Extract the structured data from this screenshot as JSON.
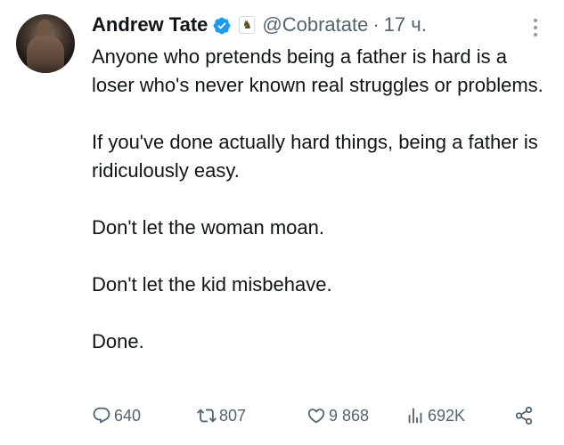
{
  "author": {
    "name": "Andrew Tate",
    "handle": "@Cobratate",
    "separator": "·",
    "time": "17 ч.",
    "verified_color": "#1d9bf0"
  },
  "tweet": {
    "paragraphs": [
      "Anyone who pretends being a father is hard is a loser who's never known real struggles or problems.",
      "If you've done actually hard things, being a father is ridiculously easy.",
      "Don't let the woman moan.",
      "Don't let the kid misbehave.",
      "Done."
    ]
  },
  "actions": {
    "replies": "640",
    "reposts": "807",
    "likes": "9 868",
    "views": "692K"
  },
  "icons": {
    "more": "more-vertical-icon",
    "reply": "reply-icon",
    "repost": "repost-icon",
    "like": "heart-icon",
    "views": "views-chart-icon",
    "share": "share-icon"
  }
}
